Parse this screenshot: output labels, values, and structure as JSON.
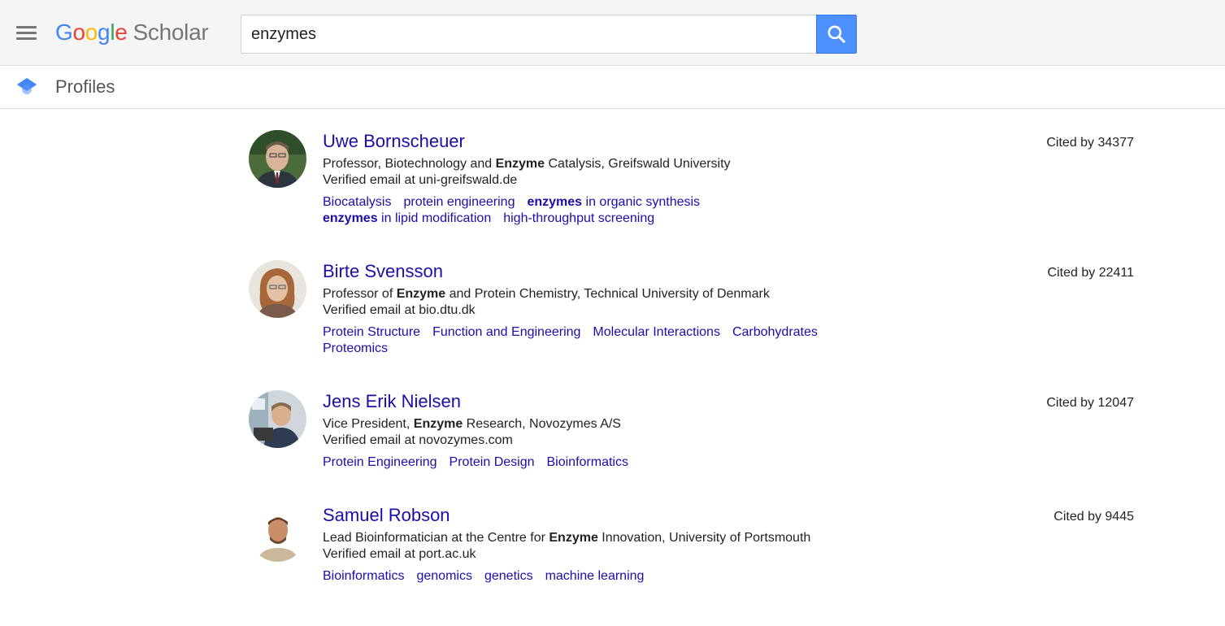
{
  "header": {
    "menu_icon": "hamburger-menu-icon",
    "logo": {
      "g1": "G",
      "o1": "o",
      "o2": "o",
      "g2": "g",
      "l": "l",
      "e": "e",
      "product": "Scholar"
    },
    "search": {
      "value": "enzymes",
      "placeholder": ""
    },
    "search_button_icon": "search-icon",
    "colors": {
      "search_button": "#4d90fe",
      "link": "#1a0dab"
    }
  },
  "subbar": {
    "icon": "graduation-cap-icon",
    "title": "Profiles"
  },
  "results": [
    {
      "name": "Uwe Bornscheuer",
      "affil_pre": "Professor, Biotechnology and ",
      "affil_bold": "Enzyme",
      "affil_post": " Catalysis, Greifswald University",
      "email": "Verified email at uni-greifswald.de",
      "cited": "Cited by 34377",
      "interests": [
        {
          "bold": "",
          "text": "Biocatalysis"
        },
        {
          "bold": "",
          "text": "protein engineering"
        },
        {
          "bold": "enzymes",
          "text": " in organic synthesis"
        },
        {
          "bold": "enzymes",
          "text": " in lipid modification"
        },
        {
          "bold": "",
          "text": "high-throughput screening"
        }
      ]
    },
    {
      "name": "Birte Svensson",
      "affil_pre": "Professor of ",
      "affil_bold": "Enzyme",
      "affil_post": " and Protein Chemistry, Technical University of Denmark",
      "email": "Verified email at bio.dtu.dk",
      "cited": "Cited by 22411",
      "interests": [
        {
          "bold": "",
          "text": "Protein Structure"
        },
        {
          "bold": "",
          "text": "Function and Engineering"
        },
        {
          "bold": "",
          "text": "Molecular Interactions"
        },
        {
          "bold": "",
          "text": "Carbohydrates"
        },
        {
          "bold": "",
          "text": "Proteomics"
        }
      ]
    },
    {
      "name": "Jens Erik Nielsen",
      "affil_pre": "Vice President, ",
      "affil_bold": "Enzyme",
      "affil_post": " Research, Novozymes A/S",
      "email": "Verified email at novozymes.com",
      "cited": "Cited by 12047",
      "interests": [
        {
          "bold": "",
          "text": "Protein Engineering"
        },
        {
          "bold": "",
          "text": "Protein Design"
        },
        {
          "bold": "",
          "text": "Bioinformatics"
        }
      ]
    },
    {
      "name": "Samuel Robson",
      "affil_pre": "Lead Bioinformatician at the Centre for ",
      "affil_bold": "Enzyme",
      "affil_post": " Innovation, University of Portsmouth",
      "email": "Verified email at port.ac.uk",
      "cited": "Cited by 9445",
      "interests": [
        {
          "bold": "",
          "text": "Bioinformatics"
        },
        {
          "bold": "",
          "text": "genomics"
        },
        {
          "bold": "",
          "text": "genetics"
        },
        {
          "bold": "",
          "text": "machine learning"
        }
      ]
    }
  ]
}
